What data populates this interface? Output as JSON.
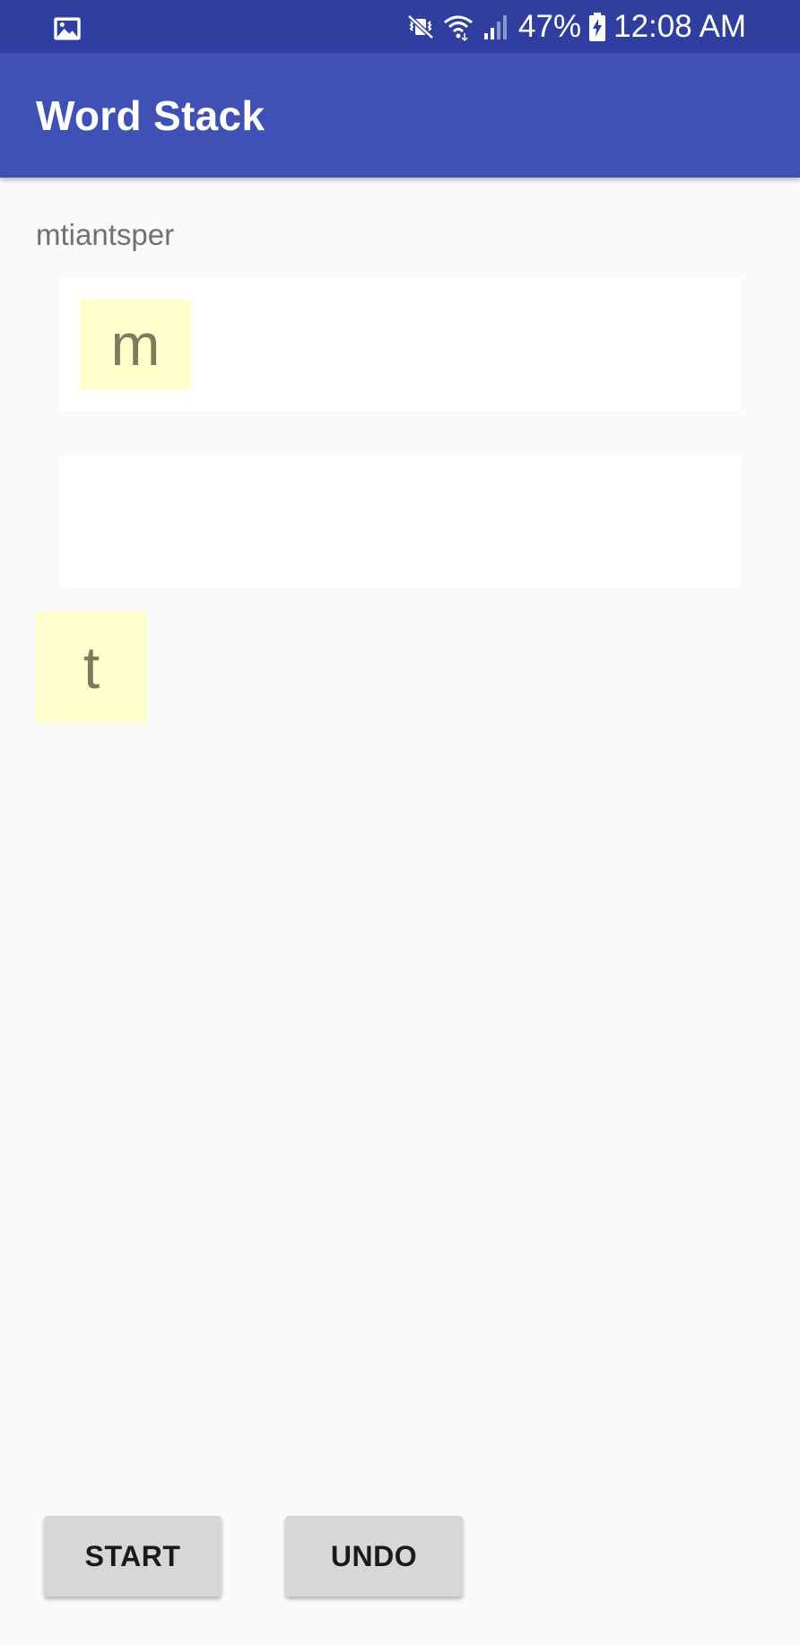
{
  "status_bar": {
    "battery_percent": "47%",
    "time": "12:08 AM",
    "icons": {
      "left": "image-notification-icon",
      "mute": "vibrate-mute-icon",
      "wifi": "wifi-icon",
      "signal": "signal-icon",
      "battery": "battery-charging-icon"
    }
  },
  "app_bar": {
    "title": "Word Stack"
  },
  "game": {
    "scrambled_word": "mtiantsper",
    "word1_tiles": [
      "m"
    ],
    "word2_tiles": [],
    "stack_top_tile": "t"
  },
  "buttons": {
    "start_label": "START",
    "undo_label": "UNDO"
  },
  "colors": {
    "status_bar": "#303f9f",
    "app_bar": "#3f51b5",
    "tile": "#ffffcc",
    "background": "#fafafa"
  }
}
